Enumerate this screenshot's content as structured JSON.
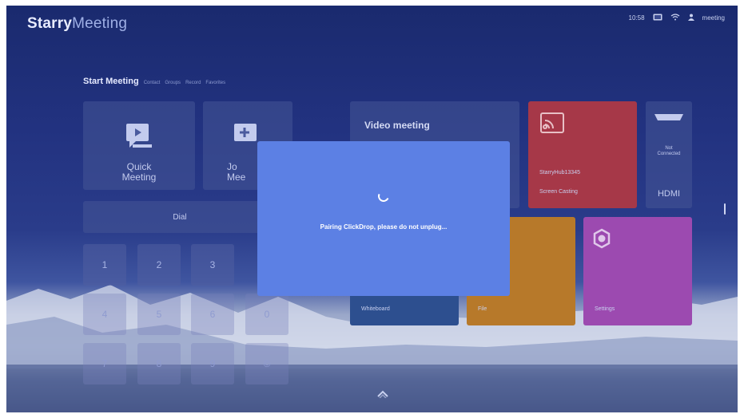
{
  "header": {
    "logo_bold": "Starry",
    "logo_thin": "Meeting",
    "time": "10:58",
    "user": "meeting"
  },
  "nav": {
    "active": "Start Meeting",
    "tabs": [
      "Contact",
      "Groups",
      "Record",
      "Favorites"
    ]
  },
  "tiles": {
    "quick_meeting": "Quick\nMeeting",
    "join_meeting": "Jo\nMee",
    "dial": "Dial",
    "video_meeting": "Video meeting",
    "screen_cast_device": "StarryHub13345",
    "screen_cast_label": "Screen Casting",
    "hdmi_status": "Not\nConnected",
    "hdmi_label": "HDMI",
    "whiteboard": "Whiteboard",
    "file": "File",
    "settings": "Settings"
  },
  "keypad": [
    "1",
    "2",
    "3",
    "4",
    "5",
    "6",
    "0",
    "7",
    "8",
    "9",
    "©"
  ],
  "dialog": {
    "message": "Pairing ClickDrop, please do not unplug..."
  },
  "colors": {
    "dialog": "#5c80e4",
    "cast_tile": "#b0343c",
    "file_tile": "#b7792a",
    "settings_tile": "#9c4ab0",
    "whiteboard_tile": "#2d4f8f"
  }
}
